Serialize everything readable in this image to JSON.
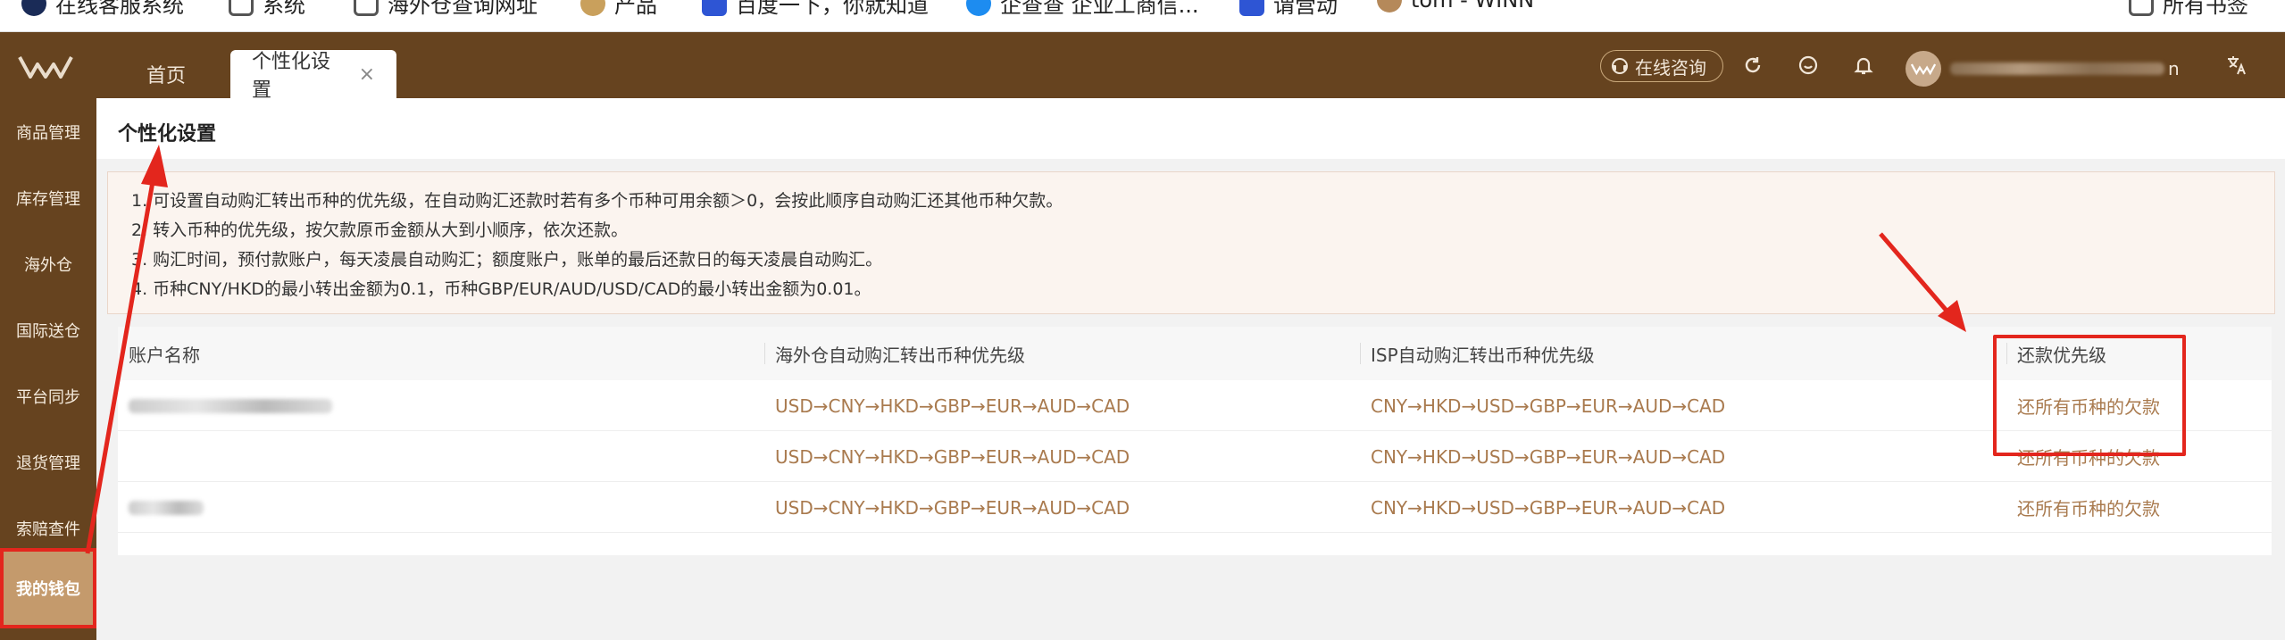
{
  "bookmarks": [
    {
      "label": "在线客服系统",
      "color": "#1a2b57"
    },
    {
      "label": "系统",
      "color": "#555555"
    },
    {
      "label": "海外仓查询网址",
      "color": "#555555"
    },
    {
      "label": "产品",
      "color": "#c9a05c"
    },
    {
      "label": "百度一下，你就知道",
      "color": "#2e55d4"
    },
    {
      "label": "企查查 企业工商信...",
      "color": "#1d8cf0"
    },
    {
      "label": "谓营动",
      "color": "#2e55d4"
    },
    {
      "label": "tom - WINN",
      "color": "#b5895a"
    },
    {
      "label": "所有书签",
      "color": "#555555"
    }
  ],
  "header": {
    "tabs": {
      "home": "首页",
      "active": "个性化设置",
      "close": "×"
    },
    "consult_label": "在线咨询",
    "user_tail": "n",
    "icons": [
      "refresh-icon",
      "smile-icon",
      "bell-icon",
      "translate-icon"
    ],
    "colors": {
      "brand": "#66431f",
      "accent": "#c49a6c"
    }
  },
  "sidebar": {
    "items": [
      {
        "label": "商品管理"
      },
      {
        "label": "库存管理"
      },
      {
        "label": "海外仓"
      },
      {
        "label": "国际送仓"
      },
      {
        "label": "平台同步"
      },
      {
        "label": "退货管理"
      },
      {
        "label": "索赔查件"
      },
      {
        "label": "我的钱包"
      }
    ],
    "active_index": 7
  },
  "page": {
    "title": "个性化设置",
    "notice": [
      "1. 可设置自动购汇转出币种的优先级，在自动购汇还款时若有多个币种可用余额＞0，会按此顺序自动购汇还其他币种欠款。",
      "2. 转入币种的优先级，按欠款原币金额从大到小顺序，依次还款。",
      "3. 购汇时间，预付款账户，每天凌晨自动购汇；额度账户，账单的最后还款日的每天凌晨自动购汇。",
      "4. 币种CNY/HKD的最小转出金额为0.1，币种GBP/EUR/AUD/USD/CAD的最小转出金额为0.01。"
    ]
  },
  "table": {
    "headers": [
      "账户名称",
      "海外仓自动购汇转出币种优先级",
      "ISP自动购汇转出币种优先级",
      "还款优先级"
    ],
    "rows": [
      {
        "account": "",
        "overseas": "USD→CNY→HKD→GBP→EUR→AUD→CAD",
        "isp": "CNY→HKD→USD→GBP→EUR→AUD→CAD",
        "repay": "还所有币种的欠款"
      },
      {
        "account": "",
        "overseas": "USD→CNY→HKD→GBP→EUR→AUD→CAD",
        "isp": "CNY→HKD→USD→GBP→EUR→AUD→CAD",
        "repay": "还所有币种的欠款"
      },
      {
        "account": "",
        "overseas": "USD→CNY→HKD→GBP→EUR→AUD→CAD",
        "isp": "CNY→HKD→USD→GBP→EUR→AUD→CAD",
        "repay": "还所有币种的欠款"
      }
    ]
  },
  "annotations": {
    "color": "#e3261d"
  }
}
